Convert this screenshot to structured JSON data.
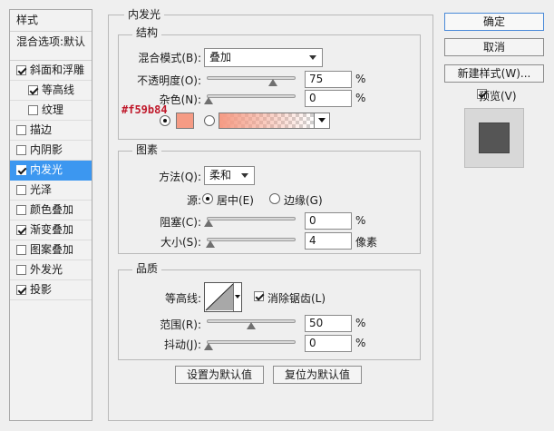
{
  "left": {
    "title": "样式",
    "blend_options": "混合选项:默认",
    "items": [
      {
        "label": "斜面和浮雕",
        "checked": true
      },
      {
        "label": "等高线",
        "checked": true
      },
      {
        "label": "纹理",
        "checked": false
      },
      {
        "label": "描边",
        "checked": false
      },
      {
        "label": "内阴影",
        "checked": false
      },
      {
        "label": "内发光",
        "checked": true,
        "active": true
      },
      {
        "label": "光泽",
        "checked": false
      },
      {
        "label": "颜色叠加",
        "checked": false
      },
      {
        "label": "渐变叠加",
        "checked": true
      },
      {
        "label": "图案叠加",
        "checked": false
      },
      {
        "label": "外发光",
        "checked": false
      },
      {
        "label": "投影",
        "checked": true
      }
    ]
  },
  "main": {
    "title": "内发光",
    "structure": {
      "title": "结构",
      "blend_mode_label": "混合模式(B):",
      "blend_mode_value": "叠加",
      "opacity_label": "不透明度(O):",
      "opacity_value": "75",
      "opacity_unit": "%",
      "opacity_pct": 0.75,
      "noise_label": "杂色(N):",
      "noise_value": "0",
      "noise_unit": "%",
      "noise_pct": 0,
      "color_hex_label": "#f59b84",
      "glow_color": "#f59b84"
    },
    "elements": {
      "title": "图素",
      "method_label": "方法(Q):",
      "method_value": "柔和",
      "source_label": "源:",
      "source_center": "居中(E)",
      "source_edge": "边缘(G)",
      "choke_label": "阻塞(C):",
      "choke_value": "0",
      "choke_unit": "%",
      "choke_pct": 0,
      "size_label": "大小(S):",
      "size_value": "4",
      "size_unit": "像素",
      "size_pct": 0.02
    },
    "quality": {
      "title": "品质",
      "contour_label": "等高线:",
      "antialias_label": "消除锯齿(L)",
      "antialias_checked": true,
      "range_label": "范围(R):",
      "range_value": "50",
      "range_unit": "%",
      "range_pct": 0.5,
      "jitter_label": "抖动(J):",
      "jitter_value": "0",
      "jitter_unit": "%",
      "jitter_pct": 0
    },
    "set_default_label": "设置为默认值",
    "reset_default_label": "复位为默认值"
  },
  "right": {
    "ok_label": "确定",
    "cancel_label": "取消",
    "new_style_label": "新建样式(W)...",
    "preview_label": "预览(V)",
    "preview_checked": true
  }
}
